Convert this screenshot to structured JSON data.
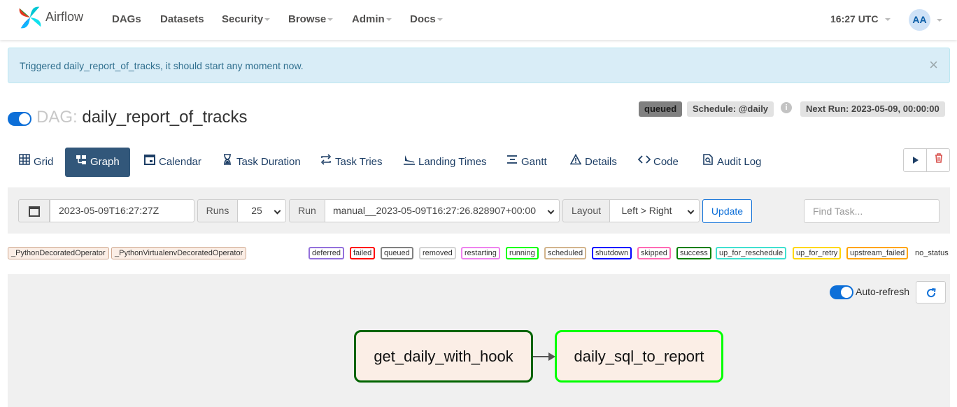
{
  "navbar": {
    "brand": "Airflow",
    "items": [
      {
        "label": "DAGs",
        "dropdown": false
      },
      {
        "label": "Datasets",
        "dropdown": false
      },
      {
        "label": "Security",
        "dropdown": true
      },
      {
        "label": "Browse",
        "dropdown": true
      },
      {
        "label": "Admin",
        "dropdown": true
      },
      {
        "label": "Docs",
        "dropdown": true
      }
    ],
    "clock": "16:27 UTC",
    "avatar": "AA"
  },
  "alert": {
    "message": "Triggered daily_report_of_tracks, it should start any moment now.",
    "close": "×"
  },
  "dag": {
    "prefix": "DAG:",
    "id": "daily_report_of_tracks",
    "paused": false,
    "state_badge": "queued",
    "schedule": "Schedule: @daily",
    "info": "i",
    "next_run": "Next Run: 2023-05-09, 00:00:00"
  },
  "tabs": [
    {
      "label": "Grid",
      "icon": "grid-icon"
    },
    {
      "label": "Graph",
      "icon": "graph-icon",
      "active": true
    },
    {
      "label": "Calendar",
      "icon": "calendar-icon"
    },
    {
      "label": "Task Duration",
      "icon": "hourglass-icon"
    },
    {
      "label": "Task Tries",
      "icon": "retry-icon"
    },
    {
      "label": "Landing Times",
      "icon": "landing-icon"
    },
    {
      "label": "Gantt",
      "icon": "gantt-icon"
    },
    {
      "label": "Details",
      "icon": "warning-icon"
    },
    {
      "label": "Code",
      "icon": "code-icon"
    },
    {
      "label": "Audit Log",
      "icon": "audit-icon"
    }
  ],
  "filters": {
    "base_date": "2023-05-09T16:27:27Z",
    "runs_label": "Runs",
    "runs_value": "25",
    "run_label": "Run",
    "run_value": "manual__2023-05-09T16:27:26.828907+00:00",
    "layout_label": "Layout",
    "layout_value": "Left > Right",
    "update": "Update",
    "find_placeholder": "Find Task..."
  },
  "operators": [
    "_PythonDecoratedOperator",
    "_PythonVirtualenvDecoratedOperator"
  ],
  "states": [
    {
      "label": "deferred",
      "color": "#9370db"
    },
    {
      "label": "failed",
      "color": "#ff0000"
    },
    {
      "label": "queued",
      "color": "#808080"
    },
    {
      "label": "removed",
      "color": "#d3d3d3"
    },
    {
      "label": "restarting",
      "color": "#ee82ee"
    },
    {
      "label": "running",
      "color": "#00ff00"
    },
    {
      "label": "scheduled",
      "color": "#d2b48c"
    },
    {
      "label": "shutdown",
      "color": "#0000ff"
    },
    {
      "label": "skipped",
      "color": "#ff69b4"
    },
    {
      "label": "success",
      "color": "#008000"
    },
    {
      "label": "up_for_reschedule",
      "color": "#40e0d0"
    },
    {
      "label": "up_for_retry",
      "color": "#ffd700"
    },
    {
      "label": "upstream_failed",
      "color": "#ffa500"
    },
    {
      "label": "no_status",
      "color": null
    }
  ],
  "graph": {
    "auto_refresh": "Auto-refresh",
    "nodes": [
      {
        "label": "get_daily_with_hook",
        "state": "success"
      },
      {
        "label": "daily_sql_to_report",
        "state": "running"
      }
    ]
  }
}
